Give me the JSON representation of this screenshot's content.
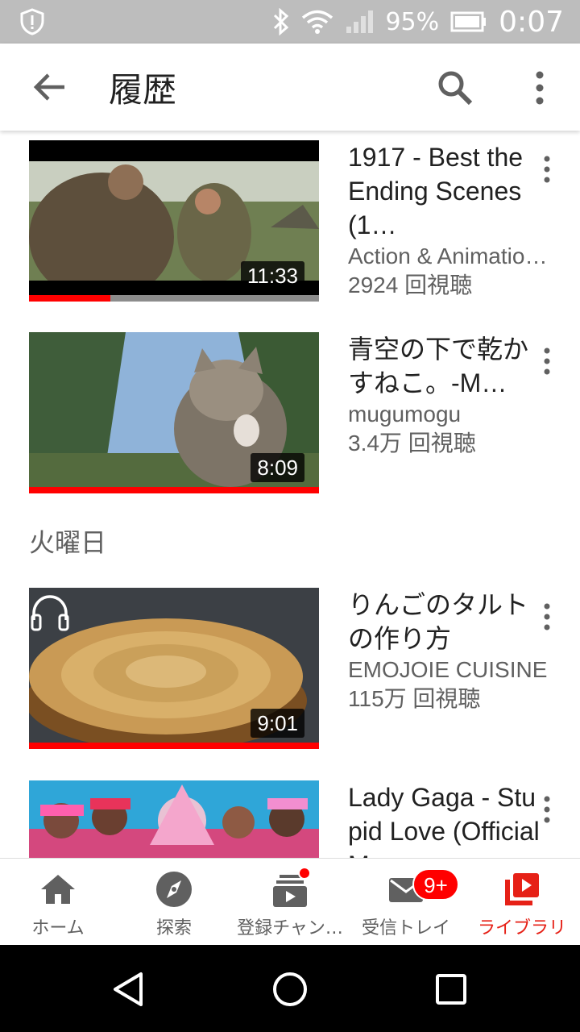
{
  "status_bar": {
    "battery": "95%",
    "time": "0:07"
  },
  "app_bar": {
    "title": "履歴"
  },
  "videos": [
    {
      "title": "1917 - Best the Ending Scenes (1…",
      "channel": "Action & Animatio…",
      "views": "2924 回視聴",
      "duration": "11:33",
      "progress": 0.28
    },
    {
      "title": "青空の下で乾かすねこ。-M…",
      "channel": "mugumogu",
      "views": "3.4万 回視聴",
      "duration": "8:09",
      "progress": 1.0
    },
    {
      "title": "りんごのタルトの作り方",
      "channel": "EMOJOIE CUISINE",
      "views": "115万 回視聴",
      "duration": "9:01",
      "progress": 1.0
    },
    {
      "title": "Lady Gaga - Stupid Love (Official M…",
      "channel": "",
      "views": "",
      "duration": "",
      "progress": 0
    }
  ],
  "section_header": "火曜日",
  "bottom_nav": {
    "items": [
      {
        "label": "ホーム",
        "icon": "home-icon"
      },
      {
        "label": "探索",
        "icon": "explore-icon"
      },
      {
        "label": "登録チャン…",
        "icon": "subscriptions-icon"
      },
      {
        "label": "受信トレイ",
        "icon": "inbox-icon",
        "badge": "9+"
      },
      {
        "label": "ライブラリ",
        "icon": "library-icon",
        "active": true
      }
    ]
  },
  "colors": {
    "accent": "#ff0000",
    "active_label": "#e62117",
    "status_bar": "#bdbdbd"
  }
}
